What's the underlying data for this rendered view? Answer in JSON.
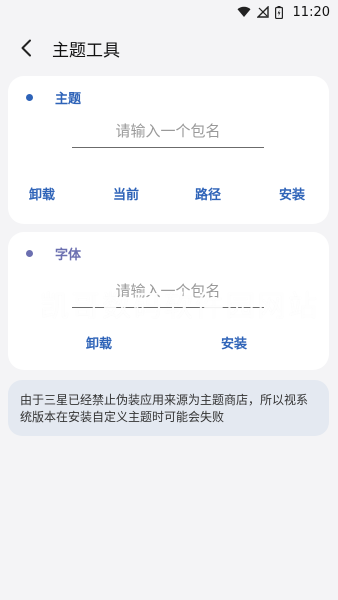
{
  "status_bar": {
    "time": "11:20",
    "icons": [
      "wifi-icon",
      "no-signal-icon",
      "battery-icon"
    ]
  },
  "appbar": {
    "back_icon": "chevron-left-icon",
    "title": "主题工具"
  },
  "theme_section": {
    "title": "主题",
    "dot_color": "#2e63b8",
    "input_placeholder": "请输入一个包名",
    "input_value": "",
    "actions": [
      "卸载",
      "当前",
      "路径",
      "安装"
    ]
  },
  "font_section": {
    "title": "字体",
    "dot_color": "#6b6fb0",
    "input_placeholder": "请输入一个包名",
    "input_value": "",
    "actions": [
      "卸载",
      "安装"
    ]
  },
  "notice": {
    "text": "由于三星已经禁止伪装应用来源为主题商店，所以视系统版本在安装自定义主题时可能会失败"
  },
  "watermark": {
    "text": "凯哥数码软件园网站"
  },
  "colors": {
    "accent": "#2e63b8",
    "background": "#f4f4f6",
    "card": "#ffffff",
    "notice_bg": "#e4e9f1"
  }
}
